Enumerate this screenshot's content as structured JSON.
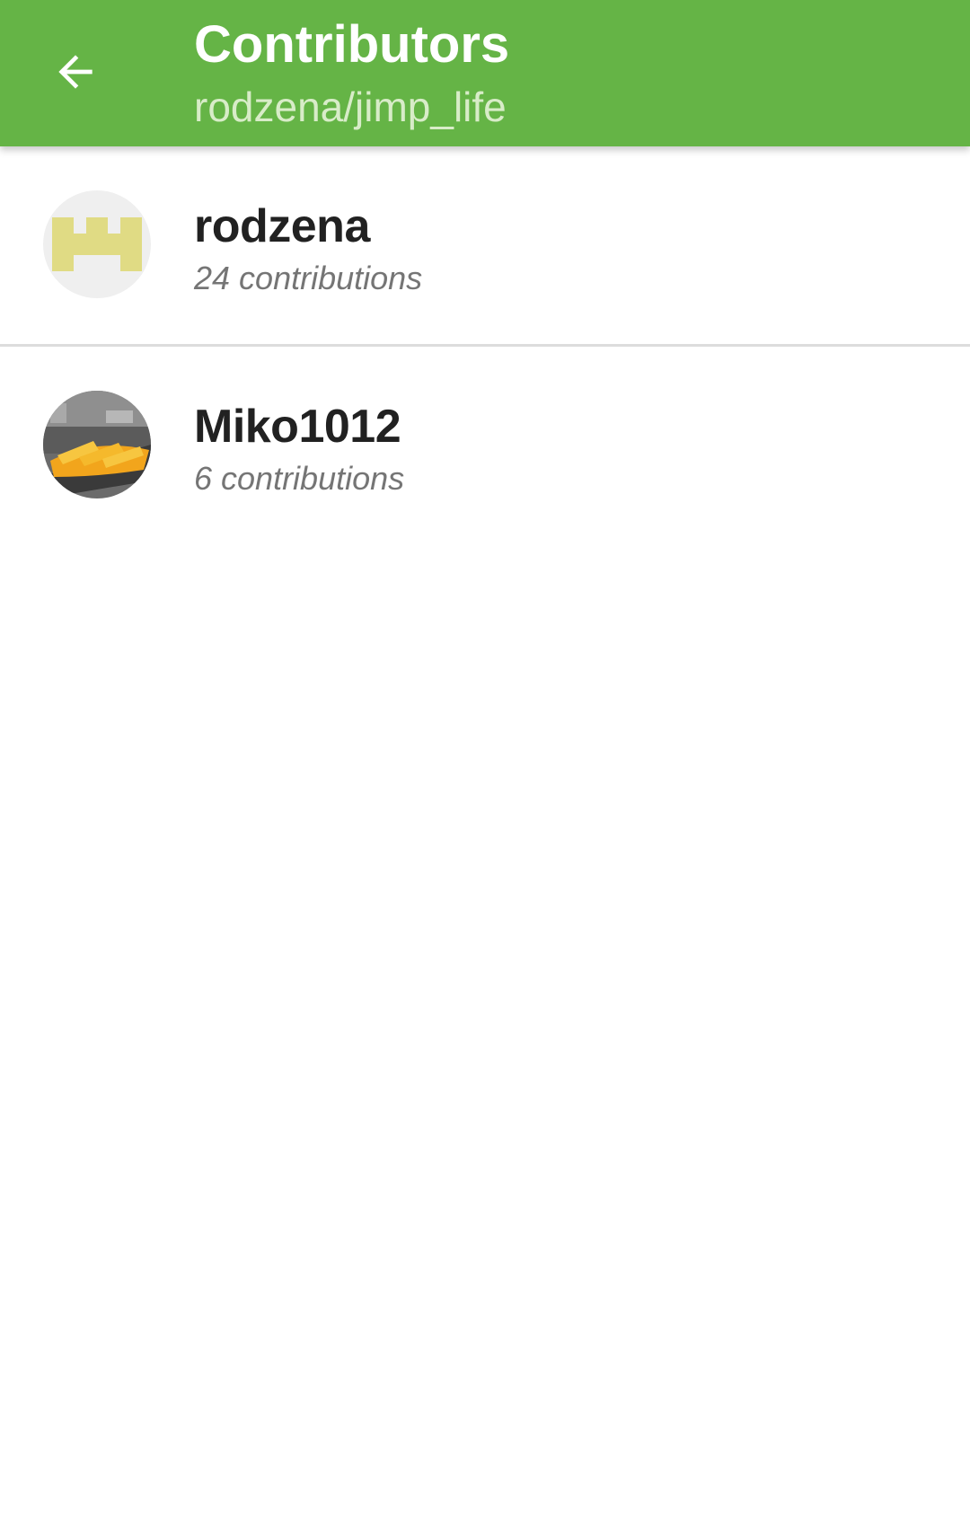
{
  "appbar": {
    "title": "Contributors",
    "subtitle": "rodzena/jimp_life",
    "back_icon": "arrow-left-icon",
    "color": "#65b446"
  },
  "contributors": [
    {
      "name": "rodzena",
      "contributions": "24 contributions",
      "avatar": "identicon-avatar",
      "avatar_color": "#e0db84"
    },
    {
      "name": "Miko1012",
      "contributions": "6 contributions",
      "avatar": "photo-avatar"
    }
  ]
}
